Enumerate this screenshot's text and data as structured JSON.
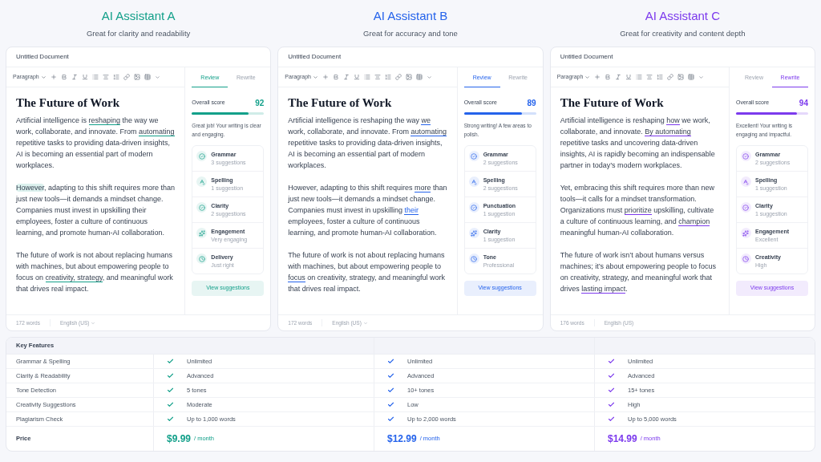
{
  "assistants": [
    {
      "name": "AI Assistant A",
      "tagline": "Great for clarity and readability",
      "color": "#13a08a",
      "doc": {
        "title": "Untitled Document",
        "format": "Paragraph",
        "heading": "The Future of Work",
        "paragraphs": [
          [
            {
              "text": "Artificial intelligence is ",
              "kind": "plain"
            },
            {
              "text": "reshaping",
              "kind": "underline"
            },
            {
              "text": " the way we work, collaborate, and innovate. From ",
              "kind": "plain"
            },
            {
              "text": "automating",
              "kind": "underline"
            },
            {
              "text": " repetitive tasks to providing data-driven insights, AI is becoming an essential part of modern workplaces.",
              "kind": "plain"
            }
          ],
          [
            {
              "text": "However",
              "kind": "highlight"
            },
            {
              "text": ", adapting to this shift requires more than just new tools—it demands a mindset change. Companies must invest in upskilling their employees, foster a culture of continuous learning, and promote human-AI collaboration.",
              "kind": "plain"
            }
          ],
          [
            {
              "text": "The future of work is not about replacing humans with machines, but about empowering people to focus on ",
              "kind": "plain"
            },
            {
              "text": "creativity, strategy",
              "kind": "underline"
            },
            {
              "text": ", and meaningful work that drives real impact.",
              "kind": "plain"
            }
          ]
        ],
        "word_count": "172 words",
        "language": "English (US)",
        "language_dropdown": true
      },
      "tabs": [
        {
          "label": "Review",
          "selected": true
        },
        {
          "label": "Rewrite",
          "selected": false
        }
      ],
      "score_label": "Overall score",
      "score": "92",
      "level": 0.78,
      "message": "Great job! Your writing is clear and engaging.",
      "categories": [
        {
          "name": "Grammar",
          "detail": "3 suggestions"
        },
        {
          "name": "Spelling",
          "detail": "1 suggestion"
        },
        {
          "name": "Clarity",
          "detail": "2 suggestions"
        },
        {
          "name": "Engagement",
          "detail": "Very engaging"
        },
        {
          "name": "Delivery",
          "detail": "Just right"
        }
      ],
      "button": "View suggestions"
    },
    {
      "name": "AI Assistant B",
      "tagline": "Great for accuracy and tone",
      "color": "#2563eb",
      "doc": {
        "title": "Untitled Document",
        "format": "Paragraph",
        "heading": "The Future of Work",
        "paragraphs": [
          [
            {
              "text": "Artificial intelligence is reshaping the way ",
              "kind": "plain"
            },
            {
              "text": "we",
              "kind": "underline"
            },
            {
              "text": " work, collaborate, and innovate. From ",
              "kind": "plain"
            },
            {
              "text": "automating",
              "kind": "underline"
            },
            {
              "text": " repetitive tasks to providing data-driven insights, AI is becoming an essential part of modern workplaces.",
              "kind": "plain"
            }
          ],
          [
            {
              "text": "However, adapting to this shift requires ",
              "kind": "plain"
            },
            {
              "text": "more",
              "kind": "underline"
            },
            {
              "text": " than just new tools—it demands a mindset change. Companies must invest in upskilling ",
              "kind": "plain"
            },
            {
              "text": "their",
              "kind": "colored"
            },
            {
              "text": " employees, foster a culture of continuous learning, and promote human-AI collaboration.",
              "kind": "plain"
            }
          ],
          [
            {
              "text": "The future of work is not about replacing humans with machines, but about empowering people to ",
              "kind": "plain"
            },
            {
              "text": "focus",
              "kind": "underline"
            },
            {
              "text": " on creativity, strategy, and meaningful work that drives real impact.",
              "kind": "plain"
            }
          ]
        ],
        "word_count": "172 words",
        "language": "English (US)",
        "language_dropdown": true
      },
      "tabs": [
        {
          "label": "Review",
          "selected": true
        },
        {
          "label": "Rewrite",
          "selected": false
        }
      ],
      "score_label": "Overall score",
      "score": "89",
      "level": 0.8,
      "message": "Strong writing! A few areas to polish.",
      "categories": [
        {
          "name": "Grammar",
          "detail": "2 suggestions"
        },
        {
          "name": "Spelling",
          "detail": "2 suggestions"
        },
        {
          "name": "Punctuation",
          "detail": "1 suggestion"
        },
        {
          "name": "Clarity",
          "detail": "1 suggestion"
        },
        {
          "name": "Tone",
          "detail": "Professional"
        }
      ],
      "button": "View suggestions"
    },
    {
      "name": "AI Assistant C",
      "tagline": "Great for creativity and content depth",
      "color": "#7c3aed",
      "doc": {
        "title": "Untitled Document",
        "format": "Paragraph",
        "heading": "The Future of Work",
        "paragraphs": [
          [
            {
              "text": "Artificial intelligence is reshaping ",
              "kind": "plain"
            },
            {
              "text": "how",
              "kind": "underline"
            },
            {
              "text": " we work, collaborate, and innovate. ",
              "kind": "plain"
            },
            {
              "text": "By automating",
              "kind": "underline"
            },
            {
              "text": " repetitive tasks and uncovering data-driven insights, AI is rapidly becoming an indispensable partner in today’s modern workplaces.",
              "kind": "plain"
            }
          ],
          [
            {
              "text": "Yet, embracing this shift requires more than new tools—it calls for a mindset transformation. Organizations must ",
              "kind": "plain"
            },
            {
              "text": "prioritize",
              "kind": "underline"
            },
            {
              "text": " upskilling, cultivate a culture of continuous learning, and ",
              "kind": "plain"
            },
            {
              "text": "champion",
              "kind": "underline"
            },
            {
              "text": " meaningful human-AI collaboration.",
              "kind": "plain"
            }
          ],
          [
            {
              "text": "The future of work isn’t about humans versus machines; it’s about empowering people to focus on creativity, strategy, and meaningful work that drives ",
              "kind": "plain"
            },
            {
              "text": "lasting impact",
              "kind": "underline"
            },
            {
              "text": ".",
              "kind": "plain"
            }
          ]
        ],
        "word_count": "176 words",
        "language": "English (US)",
        "language_dropdown": false
      },
      "tabs": [
        {
          "label": "Review",
          "selected": false
        },
        {
          "label": "Rewrite",
          "selected": true
        }
      ],
      "score_label": "Overall score",
      "score": "94",
      "level": 0.85,
      "message": "Excellent! Your writing is engaging and impactful.",
      "categories": [
        {
          "name": "Grammar",
          "detail": "2 suggestions"
        },
        {
          "name": "Spelling",
          "detail": "1 suggestion"
        },
        {
          "name": "Clarity",
          "detail": "1 suggestion"
        },
        {
          "name": "Engagement",
          "detail": "Excellent"
        },
        {
          "name": "Creativity",
          "detail": "High"
        }
      ],
      "button": "View suggestions"
    }
  ],
  "features": {
    "heading": "Key Features",
    "rows": [
      {
        "feature": "Grammar & Spelling",
        "values": [
          "Unlimited",
          "Unlimited",
          "Unlimited"
        ]
      },
      {
        "feature": "Clarity & Readability",
        "values": [
          "Advanced",
          "Advanced",
          "Advanced"
        ]
      },
      {
        "feature": "Tone Detection",
        "values": [
          "5 tones",
          "10+ tones",
          "15+ tones"
        ]
      },
      {
        "feature": "Creativity Suggestions",
        "values": [
          "Moderate",
          "Low",
          "High"
        ]
      },
      {
        "feature": "Plagiarism Check",
        "values": [
          "Up to 1,000 words",
          "Up to 2,000 words",
          "Up to 5,000 words"
        ]
      }
    ],
    "price": {
      "label": "Price",
      "values": [
        {
          "amount": "$9.99",
          "period": "/ month"
        },
        {
          "amount": "$12.99",
          "period": "/ month"
        },
        {
          "amount": "$14.99",
          "period": "/ month"
        }
      ]
    }
  }
}
